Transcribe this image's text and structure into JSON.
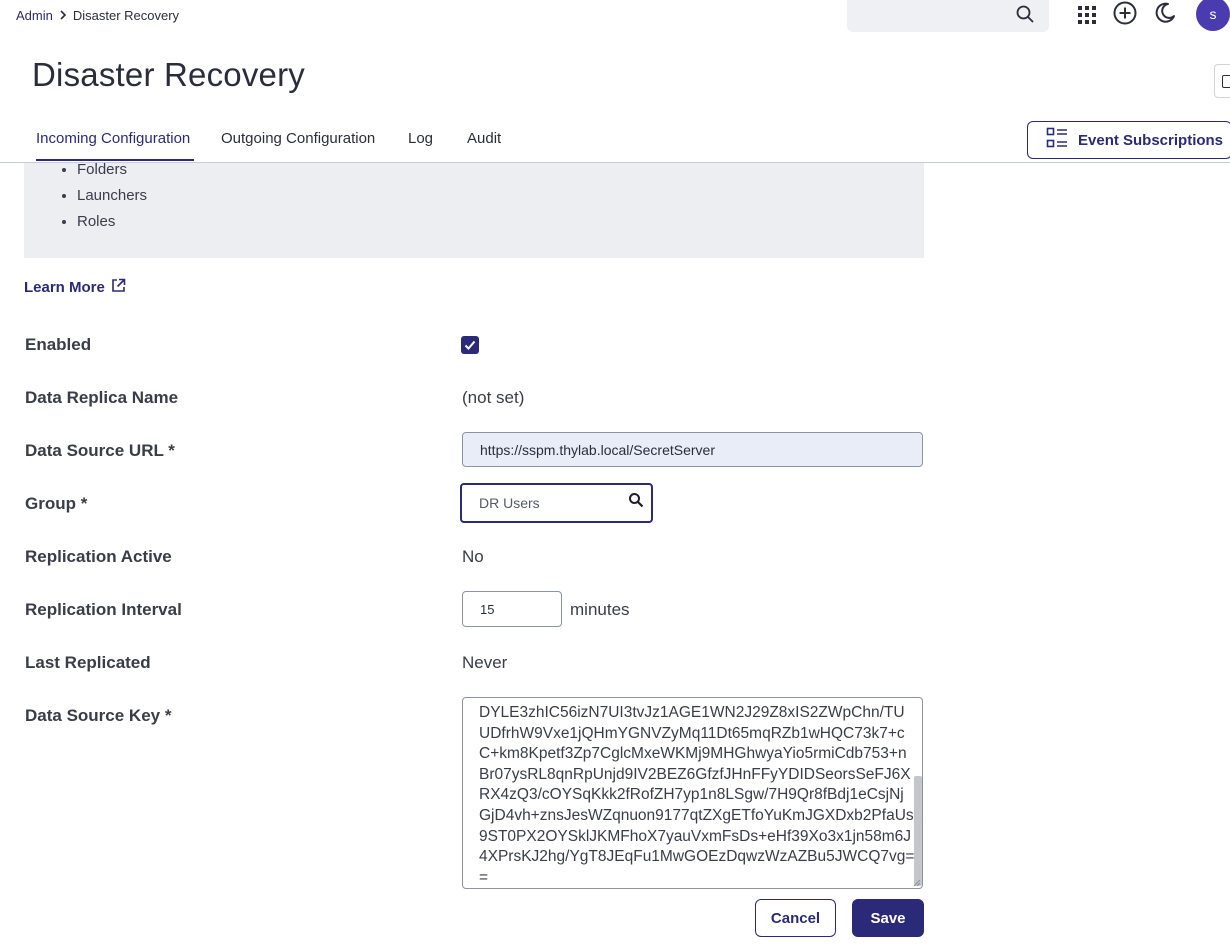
{
  "breadcrumb": {
    "parent": "Admin",
    "separator": ">",
    "current": "Disaster Recovery"
  },
  "header": {
    "search_placeholder": "",
    "avatar_initial": "s",
    "icons": [
      "search-icon",
      "apps-grid-icon",
      "add-circle-icon",
      "dark-mode-moon-icon"
    ]
  },
  "page": {
    "title": "Disaster Recovery"
  },
  "tabs": [
    {
      "label": "Incoming Configuration",
      "active": true
    },
    {
      "label": "Outgoing Configuration",
      "active": false
    },
    {
      "label": "Log",
      "active": false
    },
    {
      "label": "Audit",
      "active": false
    }
  ],
  "event_subscriptions": {
    "label": "Event Subscriptions",
    "icon": "list-details-icon"
  },
  "info_panel": {
    "items": [
      "Folders",
      "Launchers",
      "Roles"
    ]
  },
  "learn_more": {
    "label": "Learn More",
    "icon": "external-link-icon"
  },
  "form": {
    "enabled": {
      "label": "Enabled",
      "checked": true
    },
    "data_replica_name": {
      "label": "Data Replica Name",
      "value": "(not set)"
    },
    "data_source_url": {
      "label": "Data Source URL *",
      "value": "https://sspm.thylab.local/SecretServer"
    },
    "group": {
      "label": "Group *",
      "value": "DR Users"
    },
    "replication_active": {
      "label": "Replication Active",
      "value": "No"
    },
    "replication_interval": {
      "label": "Replication Interval",
      "value": "15",
      "unit": "minutes"
    },
    "last_replicated": {
      "label": "Last Replicated",
      "value": "Never"
    },
    "data_source_key": {
      "label": "Data Source Key *",
      "value": "DYLE3zhIC56izN7UI3tvJz1AGE1WN2J29Z8xIS2ZWpChn/TUUDfrhW9Vxe1jQHmYGNVZyMq11Dt65mqRZb1wHQC73k7+cC+km8Kpetf3Zp7CglcMxeWKMj9MHGhwyaYio5rmiCdb753+nBr07ysRL8qnRpUnjd9IV2BEZ6GfzfJHnFFyYDIDSeorsSeFJ6XRX4zQ3/cOYSqKkk2fRofZH7yp1n8LSgw/7H9Qr8fBdj1eCsjNjGjD4vh+znsJesWZqnuon9177qtZXgETfoYuKmJGXDxb2PfaUs9ST0PX2OYSklJKMFhoX7yauVxmFsDs+eHf39Xo3x1jn58m6J4XPrsKJ2hg/YgT8JEqFu1MwGOEzDqwzWzAZBu5JWCQ7vg=="
    }
  },
  "actions": {
    "cancel": "Cancel",
    "save": "Save"
  },
  "colors": {
    "primary": "#2a2a78",
    "avatar": "#4b3bb0",
    "panel": "#eceef2",
    "url_field": "#e8edf8"
  }
}
